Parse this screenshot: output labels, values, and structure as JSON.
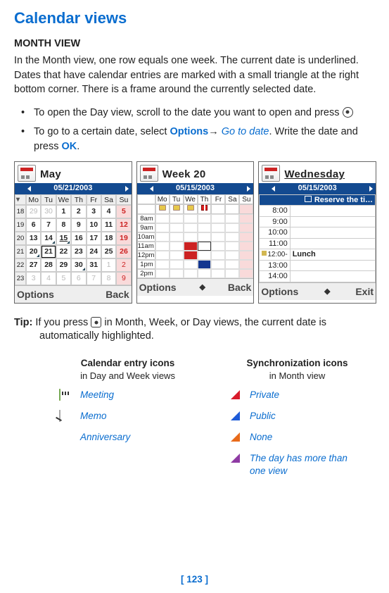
{
  "title": "Calendar views",
  "monthView": {
    "heading": "MONTH VIEW",
    "intro": "In the Month view, one row equals one week. The current date is underlined. Dates that have calendar entries are marked with a small triangle at the right bottom corner. There is a frame around the currently selected date.",
    "bullet1_a": "To open the Day view, scroll to the date you want to open and press ",
    "bullet2_a": "To go to a certain date, select ",
    "bullet2_b": "Options",
    "bullet2_c": "→ ",
    "bullet2_d": "Go to date",
    "bullet2_e": ". Write the date and press ",
    "bullet2_f": "OK",
    "bullet2_g": "."
  },
  "screenMonth": {
    "title": "May",
    "date": "05/21/2003",
    "days": [
      "Mo",
      "Tu",
      "We",
      "Th",
      "Fr",
      "Sa",
      "Su"
    ],
    "weeks": [
      "18",
      "19",
      "20",
      "21",
      "22",
      "23"
    ],
    "grid": [
      [
        "29",
        "30",
        "1",
        "2",
        "3",
        "4",
        "5"
      ],
      [
        "6",
        "7",
        "8",
        "9",
        "10",
        "11",
        "12"
      ],
      [
        "13",
        "14",
        "15",
        "16",
        "17",
        "18",
        "19"
      ],
      [
        "20",
        "21",
        "22",
        "23",
        "24",
        "25",
        "26"
      ],
      [
        "27",
        "28",
        "29",
        "30",
        "31",
        "1",
        "2"
      ],
      [
        "3",
        "4",
        "5",
        "6",
        "7",
        "8",
        "9"
      ]
    ],
    "soft_left": "Options",
    "soft_right": "Back"
  },
  "screenWeek": {
    "title": "Week 20",
    "date": "05/15/2003",
    "days": [
      "Mo",
      "Tu",
      "We",
      "Th",
      "Fr",
      "Sa",
      "Su"
    ],
    "hours": [
      "8am",
      "9am",
      "10am",
      "11am",
      "12pm",
      "1pm",
      "2pm"
    ],
    "soft_left": "Options",
    "soft_right": "Back"
  },
  "screenDay": {
    "title": "Wednesday",
    "date": "05/15/2003",
    "reserve": "Reserve the ti…",
    "rows": [
      "8:00",
      "9:00",
      "10:00",
      "11:00",
      "12:00",
      "13:00",
      "14:00"
    ],
    "lunch": "Lunch",
    "soft_left": "Options",
    "soft_right": "Exit"
  },
  "tip": {
    "label": "Tip:",
    "a": "  If you press ",
    "b": " in Month, Week, or Day views, the current date is automatically highlighted."
  },
  "icons": {
    "col1_title": "Calendar entry icons",
    "col1_sub": "in Day and Week views",
    "col2_title": "Synchronization icons",
    "col2_sub": "in Month view",
    "meeting": "Meeting",
    "memo": " Memo",
    "anniversary": "Anniversary",
    "private": "Private",
    "public": "Public",
    "none": "None",
    "multi": "The day has more than one view"
  },
  "page": "[ 123 ]"
}
